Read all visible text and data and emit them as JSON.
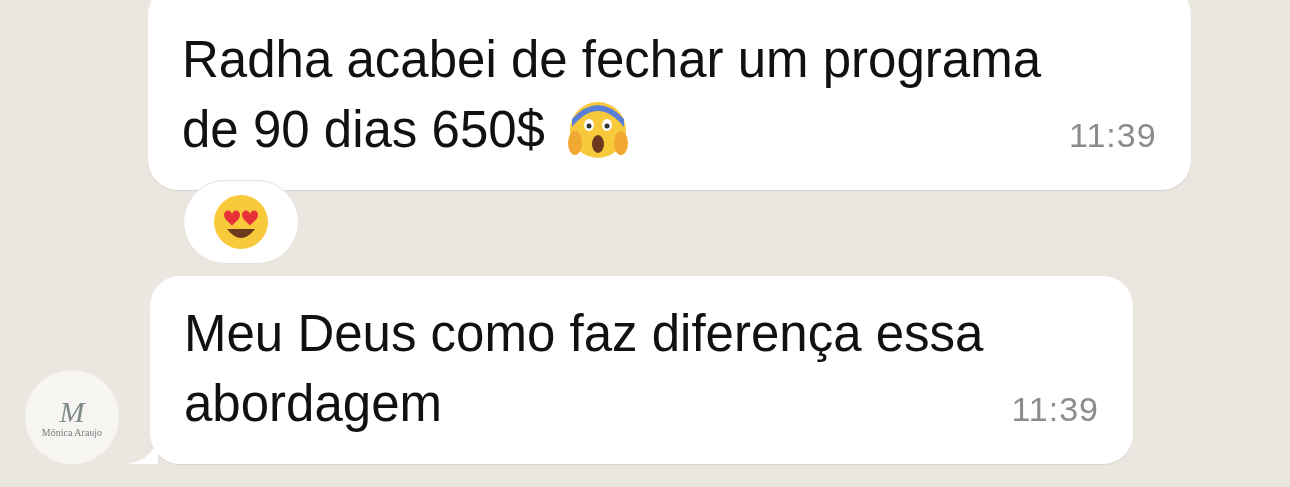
{
  "messages": [
    {
      "lines": [
        "Radha acabei de fechar um programa",
        "de 90 dias 650$"
      ],
      "emoji": {
        "kind": "scream"
      },
      "time": "11:39",
      "reaction": {
        "kind": "heart-eyes"
      }
    },
    {
      "lines": [
        "Meu Deus como faz diferença essa",
        "abordagem"
      ],
      "time": "11:39",
      "avatar": {
        "label": "Mônica Araujo",
        "monogram": "M"
      }
    }
  ]
}
